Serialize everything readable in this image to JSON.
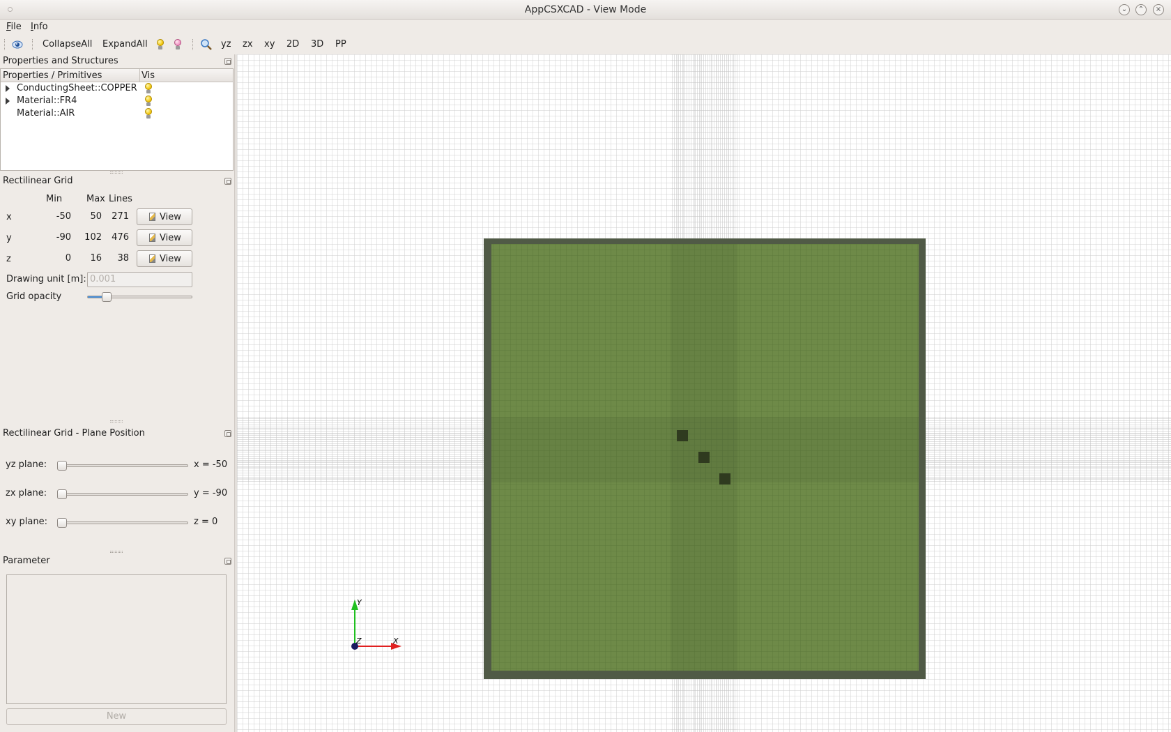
{
  "window": {
    "title": "AppCSXCAD - View Mode"
  },
  "menu": [
    {
      "label": "File",
      "mnemonic": "F",
      "rest": "ile"
    },
    {
      "label": "Info",
      "mnemonic": "I",
      "rest": "nfo"
    }
  ],
  "toolbar": {
    "collapse_all": "CollapseAll",
    "expand_all": "ExpandAll",
    "yz": "yz",
    "zx": "zx",
    "xy": "xy",
    "two_d": "2D",
    "three_d": "3D",
    "pp": "PP"
  },
  "properties_panel": {
    "title": "Properties and Structures",
    "col_primitives": "Properties / Primitives",
    "col_vis": "Vis",
    "items": [
      {
        "label": "ConductingSheet::COPPER",
        "expandable": true
      },
      {
        "label": "Material::FR4",
        "expandable": true
      },
      {
        "label": "Material::AIR",
        "expandable": false
      }
    ]
  },
  "grid_panel": {
    "title": "Rectilinear Grid",
    "col_min": "Min",
    "col_max": "Max",
    "col_lines": "Lines",
    "rows": [
      {
        "axis": "x",
        "min": "-50",
        "max": "50",
        "lines": "271",
        "button": "View"
      },
      {
        "axis": "y",
        "min": "-90",
        "max": "102",
        "lines": "476",
        "button": "View"
      },
      {
        "axis": "z",
        "min": "0",
        "max": "16",
        "lines": "38",
        "button": "View"
      }
    ],
    "drawing_unit_label": "Drawing unit [m]:",
    "drawing_unit_value": "0.001",
    "grid_opacity_label": "Grid opacity",
    "grid_opacity_level": 0.15
  },
  "plane_panel": {
    "title": "Rectilinear Grid - Plane Position",
    "planes": [
      {
        "label": "yz plane:",
        "value": "x = -50",
        "level": 0.0
      },
      {
        "label": "zx plane:",
        "value": "y = -90",
        "level": 0.0
      },
      {
        "label": "xy plane:",
        "value": "z = 0",
        "level": 0.0
      }
    ]
  },
  "parameter_panel": {
    "title": "Parameter",
    "new_button": "New"
  },
  "axes": {
    "x": "X",
    "y": "Y",
    "z": "Z"
  },
  "colors": {
    "substrate": "#6e8a48",
    "substrate_border": "#505a46",
    "axis_x": "#e02020",
    "axis_y": "#20c020",
    "axis_z": "#1a1a60"
  }
}
